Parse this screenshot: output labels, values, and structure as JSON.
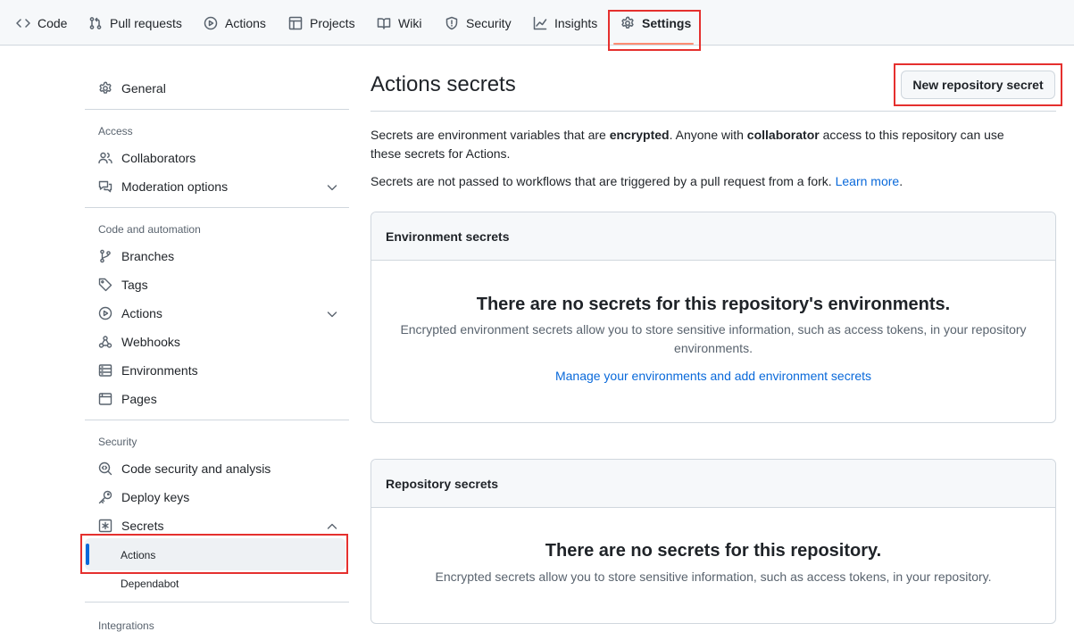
{
  "repo_nav": {
    "tabs": [
      {
        "label": "Code",
        "icon": "code-icon"
      },
      {
        "label": "Pull requests",
        "icon": "git-pull-request-icon"
      },
      {
        "label": "Actions",
        "icon": "play-icon"
      },
      {
        "label": "Projects",
        "icon": "table-icon"
      },
      {
        "label": "Wiki",
        "icon": "book-icon"
      },
      {
        "label": "Security",
        "icon": "shield-icon"
      },
      {
        "label": "Insights",
        "icon": "graph-icon"
      },
      {
        "label": "Settings",
        "icon": "gear-icon",
        "selected": true
      }
    ]
  },
  "sidebar": {
    "general": "General",
    "access_heading": "Access",
    "collaborators": "Collaborators",
    "moderation": "Moderation options",
    "code_heading": "Code and automation",
    "branches": "Branches",
    "tags": "Tags",
    "actions": "Actions",
    "webhooks": "Webhooks",
    "environments": "Environments",
    "pages": "Pages",
    "security_heading": "Security",
    "code_security": "Code security and analysis",
    "deploy_keys": "Deploy keys",
    "secrets": "Secrets",
    "secrets_actions": "Actions",
    "secrets_dependabot": "Dependabot",
    "integrations_heading": "Integrations"
  },
  "main": {
    "title": "Actions secrets",
    "new_button": "New repository secret",
    "intro_1a": "Secrets are environment variables that are ",
    "intro_1b": "encrypted",
    "intro_1c": ". Anyone with ",
    "intro_1d": "collaborator",
    "intro_1e": " access to this repository can use these secrets for Actions.",
    "intro_2": "Secrets are not passed to workflows that are triggered by a pull request from a fork. ",
    "learn_more": "Learn more",
    "learn_more_suffix": ".",
    "env_box": {
      "header": "Environment secrets",
      "empty_title": "There are no secrets for this repository's environments.",
      "empty_text": "Encrypted environment secrets allow you to store sensitive information, such as access tokens, in your repository environments.",
      "manage_link": "Manage your environments and add environment secrets"
    },
    "repo_box": {
      "header": "Repository secrets",
      "empty_title": "There are no secrets for this repository.",
      "empty_text": "Encrypted secrets allow you to store sensitive information, such as access tokens, in your repository."
    }
  },
  "colors": {
    "accent": "#0969da",
    "highlight_box": "#e5302e",
    "tab_underline": "#fd8c73"
  }
}
